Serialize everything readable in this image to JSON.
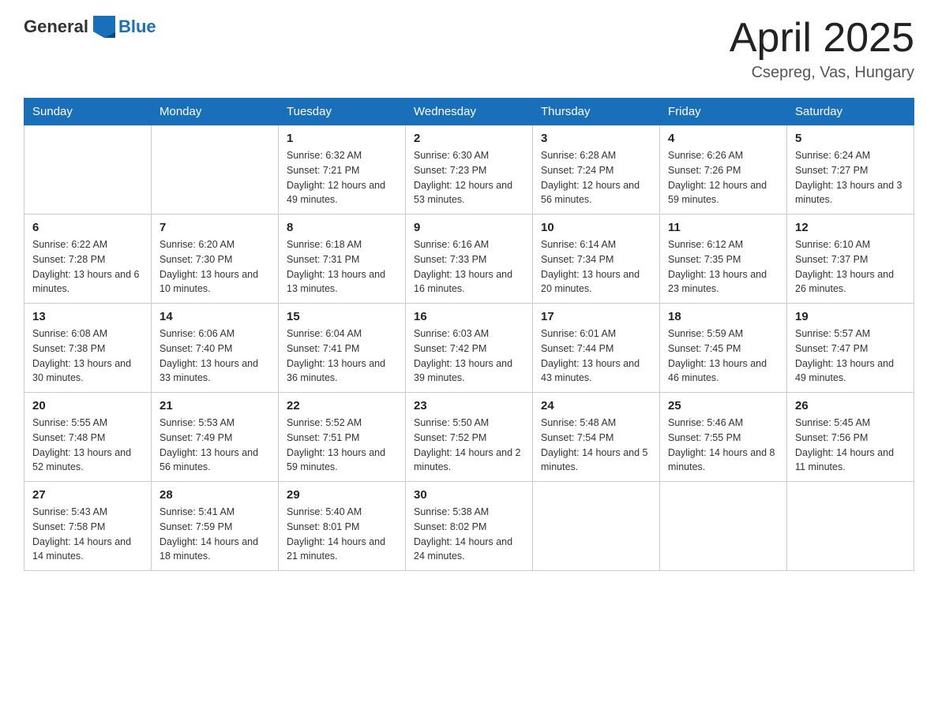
{
  "header": {
    "logo_general": "General",
    "logo_blue": "Blue",
    "month_title": "April 2025",
    "location": "Csepreg, Vas, Hungary"
  },
  "days_of_week": [
    "Sunday",
    "Monday",
    "Tuesday",
    "Wednesday",
    "Thursday",
    "Friday",
    "Saturday"
  ],
  "weeks": [
    [
      {
        "day": "",
        "sunrise": "",
        "sunset": "",
        "daylight": ""
      },
      {
        "day": "",
        "sunrise": "",
        "sunset": "",
        "daylight": ""
      },
      {
        "day": "1",
        "sunrise": "Sunrise: 6:32 AM",
        "sunset": "Sunset: 7:21 PM",
        "daylight": "Daylight: 12 hours and 49 minutes."
      },
      {
        "day": "2",
        "sunrise": "Sunrise: 6:30 AM",
        "sunset": "Sunset: 7:23 PM",
        "daylight": "Daylight: 12 hours and 53 minutes."
      },
      {
        "day": "3",
        "sunrise": "Sunrise: 6:28 AM",
        "sunset": "Sunset: 7:24 PM",
        "daylight": "Daylight: 12 hours and 56 minutes."
      },
      {
        "day": "4",
        "sunrise": "Sunrise: 6:26 AM",
        "sunset": "Sunset: 7:26 PM",
        "daylight": "Daylight: 12 hours and 59 minutes."
      },
      {
        "day": "5",
        "sunrise": "Sunrise: 6:24 AM",
        "sunset": "Sunset: 7:27 PM",
        "daylight": "Daylight: 13 hours and 3 minutes."
      }
    ],
    [
      {
        "day": "6",
        "sunrise": "Sunrise: 6:22 AM",
        "sunset": "Sunset: 7:28 PM",
        "daylight": "Daylight: 13 hours and 6 minutes."
      },
      {
        "day": "7",
        "sunrise": "Sunrise: 6:20 AM",
        "sunset": "Sunset: 7:30 PM",
        "daylight": "Daylight: 13 hours and 10 minutes."
      },
      {
        "day": "8",
        "sunrise": "Sunrise: 6:18 AM",
        "sunset": "Sunset: 7:31 PM",
        "daylight": "Daylight: 13 hours and 13 minutes."
      },
      {
        "day": "9",
        "sunrise": "Sunrise: 6:16 AM",
        "sunset": "Sunset: 7:33 PM",
        "daylight": "Daylight: 13 hours and 16 minutes."
      },
      {
        "day": "10",
        "sunrise": "Sunrise: 6:14 AM",
        "sunset": "Sunset: 7:34 PM",
        "daylight": "Daylight: 13 hours and 20 minutes."
      },
      {
        "day": "11",
        "sunrise": "Sunrise: 6:12 AM",
        "sunset": "Sunset: 7:35 PM",
        "daylight": "Daylight: 13 hours and 23 minutes."
      },
      {
        "day": "12",
        "sunrise": "Sunrise: 6:10 AM",
        "sunset": "Sunset: 7:37 PM",
        "daylight": "Daylight: 13 hours and 26 minutes."
      }
    ],
    [
      {
        "day": "13",
        "sunrise": "Sunrise: 6:08 AM",
        "sunset": "Sunset: 7:38 PM",
        "daylight": "Daylight: 13 hours and 30 minutes."
      },
      {
        "day": "14",
        "sunrise": "Sunrise: 6:06 AM",
        "sunset": "Sunset: 7:40 PM",
        "daylight": "Daylight: 13 hours and 33 minutes."
      },
      {
        "day": "15",
        "sunrise": "Sunrise: 6:04 AM",
        "sunset": "Sunset: 7:41 PM",
        "daylight": "Daylight: 13 hours and 36 minutes."
      },
      {
        "day": "16",
        "sunrise": "Sunrise: 6:03 AM",
        "sunset": "Sunset: 7:42 PM",
        "daylight": "Daylight: 13 hours and 39 minutes."
      },
      {
        "day": "17",
        "sunrise": "Sunrise: 6:01 AM",
        "sunset": "Sunset: 7:44 PM",
        "daylight": "Daylight: 13 hours and 43 minutes."
      },
      {
        "day": "18",
        "sunrise": "Sunrise: 5:59 AM",
        "sunset": "Sunset: 7:45 PM",
        "daylight": "Daylight: 13 hours and 46 minutes."
      },
      {
        "day": "19",
        "sunrise": "Sunrise: 5:57 AM",
        "sunset": "Sunset: 7:47 PM",
        "daylight": "Daylight: 13 hours and 49 minutes."
      }
    ],
    [
      {
        "day": "20",
        "sunrise": "Sunrise: 5:55 AM",
        "sunset": "Sunset: 7:48 PM",
        "daylight": "Daylight: 13 hours and 52 minutes."
      },
      {
        "day": "21",
        "sunrise": "Sunrise: 5:53 AM",
        "sunset": "Sunset: 7:49 PM",
        "daylight": "Daylight: 13 hours and 56 minutes."
      },
      {
        "day": "22",
        "sunrise": "Sunrise: 5:52 AM",
        "sunset": "Sunset: 7:51 PM",
        "daylight": "Daylight: 13 hours and 59 minutes."
      },
      {
        "day": "23",
        "sunrise": "Sunrise: 5:50 AM",
        "sunset": "Sunset: 7:52 PM",
        "daylight": "Daylight: 14 hours and 2 minutes."
      },
      {
        "day": "24",
        "sunrise": "Sunrise: 5:48 AM",
        "sunset": "Sunset: 7:54 PM",
        "daylight": "Daylight: 14 hours and 5 minutes."
      },
      {
        "day": "25",
        "sunrise": "Sunrise: 5:46 AM",
        "sunset": "Sunset: 7:55 PM",
        "daylight": "Daylight: 14 hours and 8 minutes."
      },
      {
        "day": "26",
        "sunrise": "Sunrise: 5:45 AM",
        "sunset": "Sunset: 7:56 PM",
        "daylight": "Daylight: 14 hours and 11 minutes."
      }
    ],
    [
      {
        "day": "27",
        "sunrise": "Sunrise: 5:43 AM",
        "sunset": "Sunset: 7:58 PM",
        "daylight": "Daylight: 14 hours and 14 minutes."
      },
      {
        "day": "28",
        "sunrise": "Sunrise: 5:41 AM",
        "sunset": "Sunset: 7:59 PM",
        "daylight": "Daylight: 14 hours and 18 minutes."
      },
      {
        "day": "29",
        "sunrise": "Sunrise: 5:40 AM",
        "sunset": "Sunset: 8:01 PM",
        "daylight": "Daylight: 14 hours and 21 minutes."
      },
      {
        "day": "30",
        "sunrise": "Sunrise: 5:38 AM",
        "sunset": "Sunset: 8:02 PM",
        "daylight": "Daylight: 14 hours and 24 minutes."
      },
      {
        "day": "",
        "sunrise": "",
        "sunset": "",
        "daylight": ""
      },
      {
        "day": "",
        "sunrise": "",
        "sunset": "",
        "daylight": ""
      },
      {
        "day": "",
        "sunrise": "",
        "sunset": "",
        "daylight": ""
      }
    ]
  ]
}
